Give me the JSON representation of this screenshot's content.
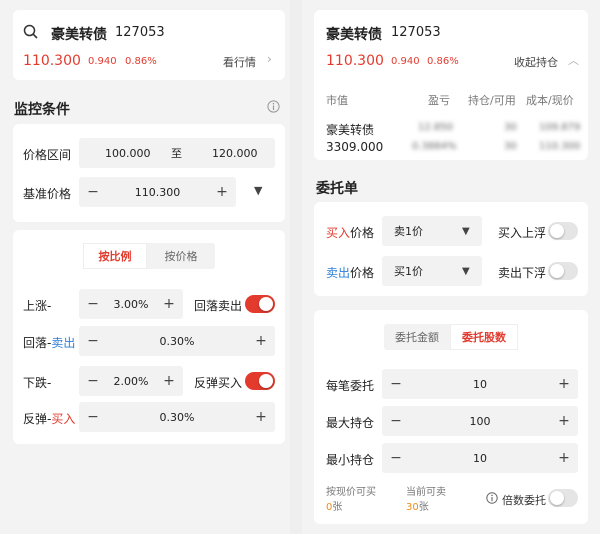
{
  "left": {
    "stock": {
      "name": "豪美转债",
      "code": "127053",
      "price": "110.300",
      "change": "0.940",
      "pct": "0.86%",
      "market_link": "看行情"
    },
    "monitor": {
      "title": "监控条件",
      "price_range_label": "价格区间",
      "price_from": "100.000",
      "to_label": "至",
      "price_to": "120.000",
      "base_label": "基准价格",
      "base_value": "110.300"
    },
    "strategy": {
      "tab_ratio": "按比例",
      "tab_price": "按价格",
      "rise_label": "上涨-",
      "rise_value": "3.00%",
      "rise_toggle_label": "回落卖出",
      "fallback_label_a": "回落-",
      "fallback_label_b": "卖出",
      "fallback_value": "0.30%",
      "fall_label": "下跌-",
      "fall_value": "2.00%",
      "fall_toggle_label": "反弹买入",
      "rebound_label_a": "反弹-",
      "rebound_label_b": "买入",
      "rebound_value": "0.30%"
    }
  },
  "right": {
    "stock": {
      "name": "豪美转债",
      "code": "127053",
      "price": "110.300",
      "change": "0.940",
      "pct": "0.86%",
      "collapse_link": "收起持仓"
    },
    "holdings": {
      "col_value": "市值",
      "col_pl": "盈亏",
      "col_pos": "持仓/可用",
      "col_cost": "成本/现价",
      "row_name": "豪美转债",
      "row_value": "3309.000",
      "pl_1": "12.850",
      "pl_2": "0.3884%",
      "pos_1": "30",
      "pos_2": "30",
      "cost_1": "109.879",
      "cost_2": "110.300"
    },
    "order": {
      "title": "委托单",
      "buy_label_a": "买入",
      "buy_label_b": "价格",
      "buy_select": "卖1价",
      "buy_float_label": "买入上浮",
      "sell_label_a": "卖出",
      "sell_label_b": "价格",
      "sell_select": "买1价",
      "sell_float_label": "卖出下浮",
      "tab_amount": "委托金额",
      "tab_shares": "委托股数",
      "per_label": "每笔委托",
      "per_value": "10",
      "max_label": "最大持仓",
      "max_value": "100",
      "min_label": "最小持仓",
      "min_value": "10",
      "can_buy_label": "按现价可买",
      "can_buy_value": "0",
      "can_sell_label": "当前可卖",
      "can_sell_value": "30",
      "unit": "张",
      "multiple_label": "倍数委托"
    }
  },
  "colors": {
    "accent_red": "#e23b2e",
    "accent_blue": "#2f7fd8",
    "accent_orange": "#f08a1a"
  }
}
